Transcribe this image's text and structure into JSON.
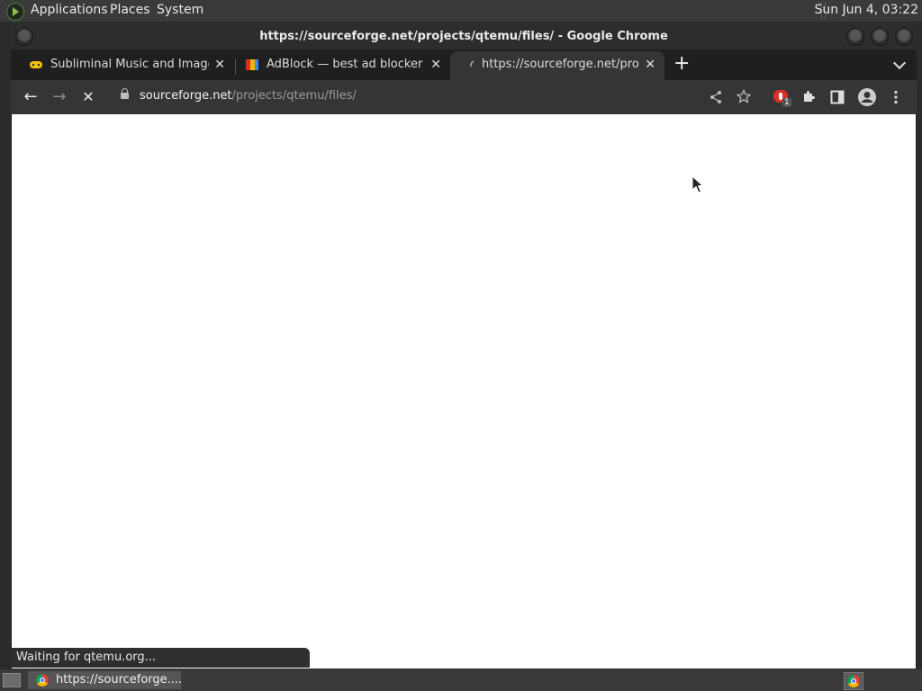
{
  "top_panel": {
    "menus": [
      "Applications",
      "Places",
      "System"
    ],
    "clock": "Sun Jun  4, 03:22"
  },
  "window": {
    "title": "https://sourceforge.net/projects/qtemu/files/ - Google Chrome"
  },
  "tabs": [
    {
      "title": "Subliminal Music and Images (",
      "close": "✕",
      "favicon": "gamepad-icon"
    },
    {
      "title": "AdBlock — best ad blocker - C",
      "close": "✕",
      "favicon": "adblock-icon"
    },
    {
      "title": "https://sourceforge.net/project",
      "close": "✕",
      "favicon": "loading-icon"
    }
  ],
  "toolbar": {
    "back": "←",
    "forward": "→",
    "stop": "✕",
    "url_host": "sourceforge.net",
    "url_path": "/projects/qtemu/files/",
    "extension_badge": "1"
  },
  "status": "Waiting for qtemu.org...",
  "taskbar": {
    "task_label": "https://sourceforge...."
  }
}
